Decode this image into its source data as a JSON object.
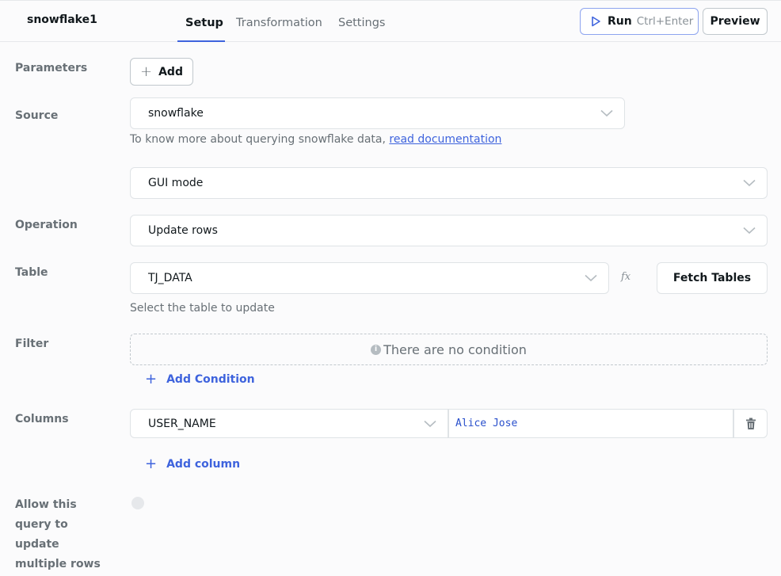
{
  "header": {
    "query_name": "snowflake1",
    "tabs": [
      {
        "label": "Setup",
        "active": true
      },
      {
        "label": "Transformation",
        "active": false
      },
      {
        "label": "Settings",
        "active": false
      }
    ],
    "run_label": "Run",
    "run_shortcut": "Ctrl+Enter",
    "preview_label": "Preview"
  },
  "parameters": {
    "label": "Parameters",
    "add_label": "Add"
  },
  "source": {
    "label": "Source",
    "value": "snowflake",
    "help_prefix": "To know more about querying snowflake data, ",
    "help_link": "read documentation"
  },
  "mode": {
    "value": "GUI mode"
  },
  "operation": {
    "label": "Operation",
    "value": "Update rows"
  },
  "table": {
    "label": "Table",
    "value": "TJ_DATA",
    "fx_label": "fx",
    "fetch_label": "Fetch Tables",
    "help": "Select the table to update"
  },
  "filter": {
    "label": "Filter",
    "empty_message": "There are no condition",
    "add_condition_label": "Add Condition"
  },
  "columns": {
    "label": "Columns",
    "rows": [
      {
        "column": "USER_NAME",
        "value": "Alice Jose"
      }
    ],
    "add_column_label": "Add column"
  },
  "multi_rows": {
    "label": "Allow this query to update multiple rows",
    "enabled": false
  },
  "colors": {
    "accent": "#3e63dd",
    "muted_text": "#687076",
    "border": "#dfe3e6"
  }
}
